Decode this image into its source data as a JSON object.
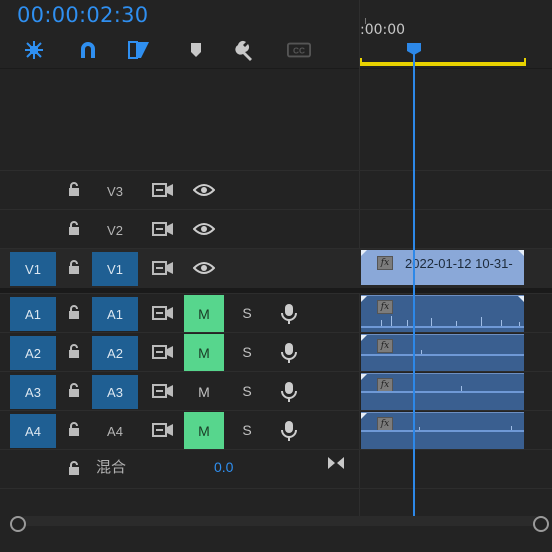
{
  "header": {
    "timecode": "00:00:02:30",
    "ruler_start": ":00:00",
    "tools": [
      {
        "name": "nest-icon",
        "color": "#2f8ff0"
      },
      {
        "name": "snap-magnet-icon",
        "color": "#2f8ff0"
      },
      {
        "name": "linked-selection-icon",
        "color": "#2f8ff0"
      },
      {
        "name": "add-marker-icon",
        "color": "#c8c8c8"
      },
      {
        "name": "settings-wrench-icon",
        "color": "#c8c8c8"
      },
      {
        "name": "captions-icon",
        "color": "#555555"
      }
    ]
  },
  "video_tracks": [
    {
      "name": "V3",
      "source": "",
      "source_on": false,
      "target_on": false
    },
    {
      "name": "V2",
      "source": "",
      "source_on": false,
      "target_on": false
    },
    {
      "name": "V1",
      "source": "V1",
      "source_on": true,
      "target_on": true
    }
  ],
  "audio_tracks": [
    {
      "name": "A1",
      "source": "A1",
      "mute_label": "M",
      "mute_on": true,
      "solo_label": "S"
    },
    {
      "name": "A2",
      "source": "A2",
      "mute_label": "M",
      "mute_on": true,
      "solo_label": "S"
    },
    {
      "name": "A3",
      "source": "A3",
      "mute_label": "M",
      "mute_on": false,
      "solo_label": "S"
    },
    {
      "name": "A4",
      "source": "A4",
      "mute_label": "M",
      "mute_on": true,
      "solo_label": "S"
    }
  ],
  "mix": {
    "label": "混合",
    "value": "0.0"
  },
  "video_clip": {
    "title": "2022-01-12 10-31-",
    "fx": "fx"
  },
  "audio_clip": {
    "fx": "fx"
  },
  "colors": {
    "accent": "#2f8ff0",
    "patch_on": "#1f5f93",
    "mute_on": "#57d68d",
    "video_clip": "#8aa8d8",
    "audio_clip": "#3a5f90",
    "work_area": "#e8d200",
    "playhead": "#2d88e8"
  }
}
